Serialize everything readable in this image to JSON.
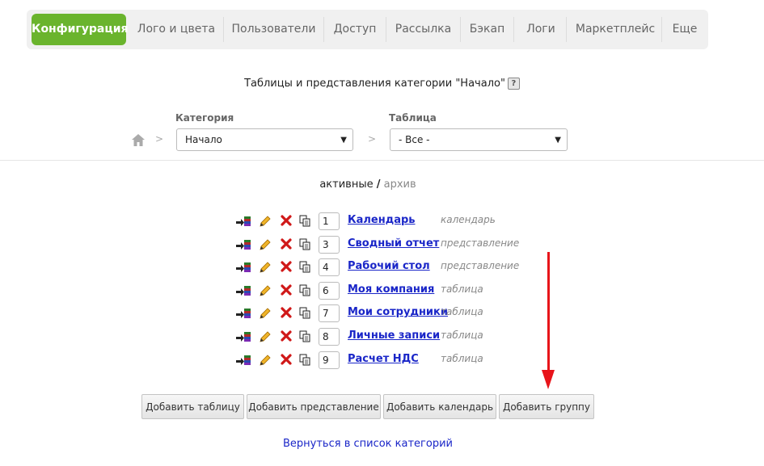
{
  "nav": {
    "tabs": [
      {
        "label": "Конфигурация",
        "active": true
      },
      {
        "label": "Лого и цвета"
      },
      {
        "label": "Пользователи"
      },
      {
        "label": "Доступ"
      },
      {
        "label": "Рассылка"
      },
      {
        "label": "Бэкап"
      },
      {
        "label": "Логи"
      },
      {
        "label": "Маркетплейс"
      },
      {
        "label": "Еще"
      }
    ]
  },
  "page": {
    "title": "Таблицы и представления категории \"Начало\"",
    "help_label": "?"
  },
  "filters": {
    "crumb_sep": ">",
    "category_label": "Категория",
    "category_value": "Начало",
    "table_label": "Таблица",
    "table_value": "- Все -",
    "dropdown_arrow": "▼"
  },
  "view_toggle": {
    "active": "активные",
    "slash": "/",
    "archive": "архив"
  },
  "rows": [
    {
      "order": "1",
      "name": "Календарь",
      "type": "календарь"
    },
    {
      "order": "3",
      "name": "Сводный отчет",
      "type": "представление"
    },
    {
      "order": "4",
      "name": "Рабочий стол",
      "type": "представление"
    },
    {
      "order": "6",
      "name": "Моя компания",
      "type": "таблица"
    },
    {
      "order": "7",
      "name": "Мои сотрудники",
      "type": "таблица"
    },
    {
      "order": "8",
      "name": "Личные записи",
      "type": "таблица"
    },
    {
      "order": "9",
      "name": "Расчет НДС",
      "type": "таблица"
    }
  ],
  "row_icons": [
    "move-to-archive-icon",
    "edit-pencil-icon",
    "delete-x-icon",
    "copy-icon"
  ],
  "buttons": {
    "add_table": "Добавить таблицу",
    "add_view": "Добавить представление",
    "add_calendar": "Добавить календарь",
    "add_group": "Добавить группу"
  },
  "back_link": "Вернуться в список категорий",
  "colors": {
    "accent_green": "#6ab42d",
    "link_blue": "#1a26c8",
    "annotation_red": "#e8141a"
  }
}
